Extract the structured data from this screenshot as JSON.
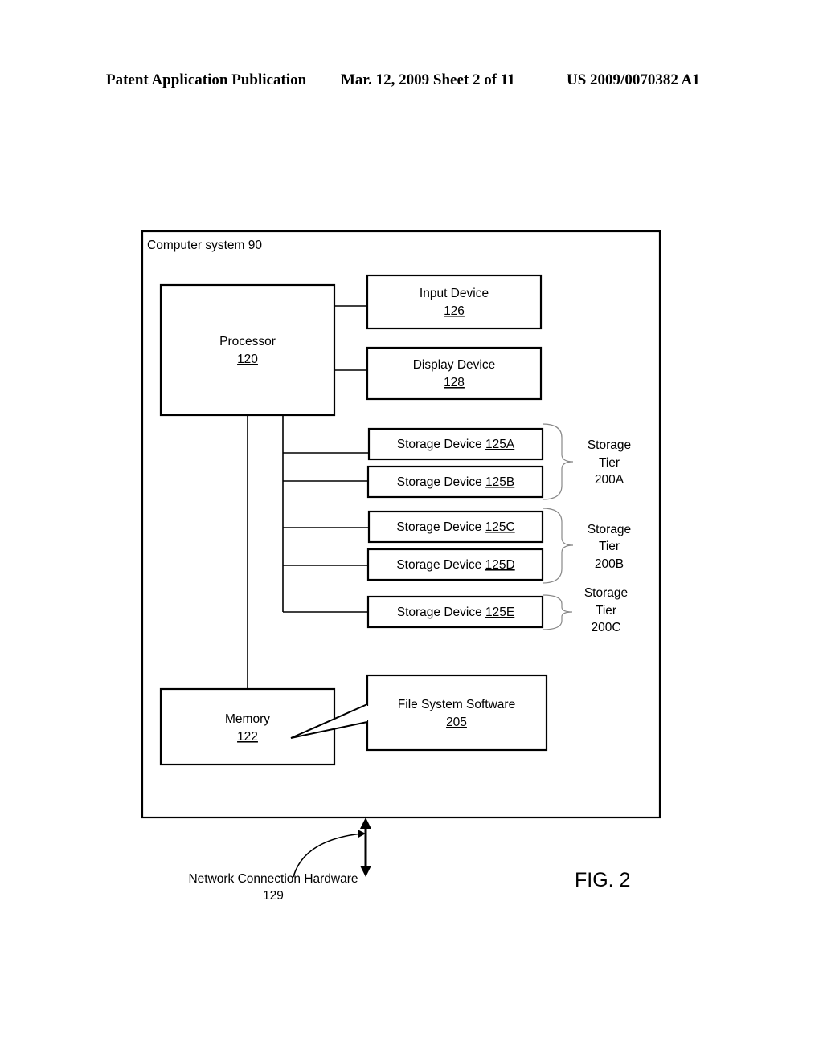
{
  "header": {
    "left": "Patent Application Publication",
    "center": "Mar. 12, 2009  Sheet 2 of 11",
    "right": "US 2009/0070382 A1"
  },
  "diagram": {
    "system_label": "Computer system 90",
    "processor": {
      "name": "Processor",
      "ref": "120"
    },
    "input_device": {
      "name": "Input Device",
      "ref": "126"
    },
    "display_device": {
      "name": "Display Device",
      "ref": "128"
    },
    "storage_devices": [
      {
        "name": "Storage Device ",
        "ref": "125A"
      },
      {
        "name": "Storage Device ",
        "ref": "125B"
      },
      {
        "name": "Storage Device ",
        "ref": "125C"
      },
      {
        "name": "Storage Device ",
        "ref": "125D"
      },
      {
        "name": "Storage Device ",
        "ref": "125E"
      }
    ],
    "storage_tiers": [
      {
        "line1": "Storage",
        "line2": "Tier",
        "line3": "200A"
      },
      {
        "line1": "Storage",
        "line2": "Tier",
        "line3": "200B"
      },
      {
        "line1": "Storage",
        "line2": "Tier",
        "line3": "200C"
      }
    ],
    "memory": {
      "name": "Memory",
      "ref": "122"
    },
    "file_system": {
      "name": "File System Software",
      "ref": "205"
    },
    "network": {
      "name": "Network Connection Hardware",
      "ref": "129"
    },
    "figure_label": "FIG. 2"
  }
}
